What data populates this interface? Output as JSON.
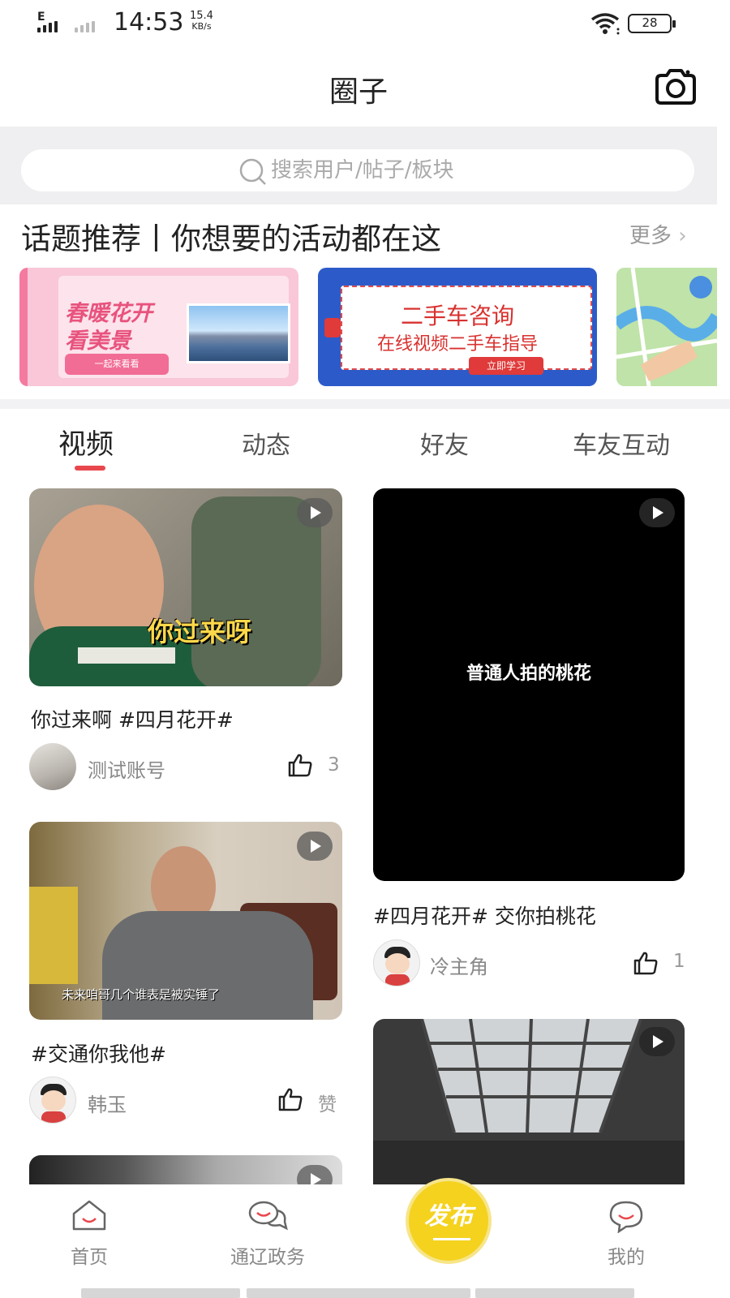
{
  "status_bar": {
    "network_type": "E",
    "time": "14:53",
    "speed_value": "15.4",
    "speed_unit": "KB/s",
    "battery": "28"
  },
  "header": {
    "title": "圈子",
    "camera_icon": "camera-icon"
  },
  "search": {
    "placeholder": "搜索用户/帖子/板块"
  },
  "topics": {
    "heading": "话题推荐丨你想要的活动都在这",
    "more_label": "更多",
    "banners": [
      {
        "line1": "春暖花开",
        "line2": "看美景",
        "button": "一起来看看"
      },
      {
        "line1": "二手车咨询",
        "line2": "在线视频二手车指导",
        "button": "立即学习"
      },
      {
        "line1": "",
        "line2": "",
        "button": ""
      }
    ]
  },
  "tabs": [
    {
      "label": "视频",
      "active": true
    },
    {
      "label": "动态",
      "active": false
    },
    {
      "label": "好友",
      "active": false
    },
    {
      "label": "车友互动",
      "active": false
    }
  ],
  "feed": {
    "left": [
      {
        "overlay_text": "你过来呀",
        "caption": "你过来啊 #四月花开#",
        "user": "测试账号",
        "likes": "3"
      },
      {
        "overlay_text": "未来咱哥几个谁表是被实锤了",
        "caption": "#交通你我他#",
        "user": "韩玉",
        "likes": "赞"
      }
    ],
    "right": [
      {
        "overlay_text": "普通人拍的桃花",
        "caption": "#四月花开# 交你拍桃花",
        "user": "冷主角",
        "likes": "1"
      }
    ]
  },
  "nav": {
    "items": [
      {
        "label": "首页",
        "icon": "home-icon"
      },
      {
        "label": "通辽政务",
        "icon": "chat-bubbles-icon"
      },
      {
        "label": "我的",
        "icon": "smile-bubble-icon"
      }
    ],
    "publish_label": "发布"
  },
  "colors": {
    "accent_red": "#e8484d",
    "publish_yellow": "#f4d21e"
  }
}
